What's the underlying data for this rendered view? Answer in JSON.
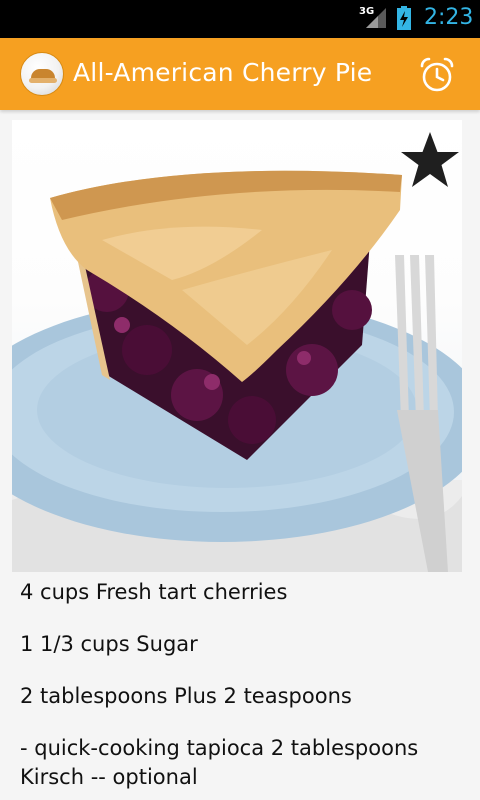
{
  "status_bar": {
    "network": "3G",
    "time": "2:23"
  },
  "action_bar": {
    "title": "All-American Cherry Pie",
    "app_icon": "pie-logo-icon",
    "action_icon": "alarm-clock-icon"
  },
  "recipe": {
    "image_icon": "cherry-pie-photo",
    "favorite_icon": "star-icon",
    "ingredients": [
      "4 cups Fresh tart cherries",
      "1 1/3 cups Sugar",
      "2 tablespoons Plus 2 teaspoons",
      "- quick-cooking tapioca 2 tablespoons Kirsch -- optional"
    ]
  },
  "colors": {
    "action_bar": "#f6a021",
    "status_accent": "#33b5e5",
    "background": "#f5f5f5"
  }
}
